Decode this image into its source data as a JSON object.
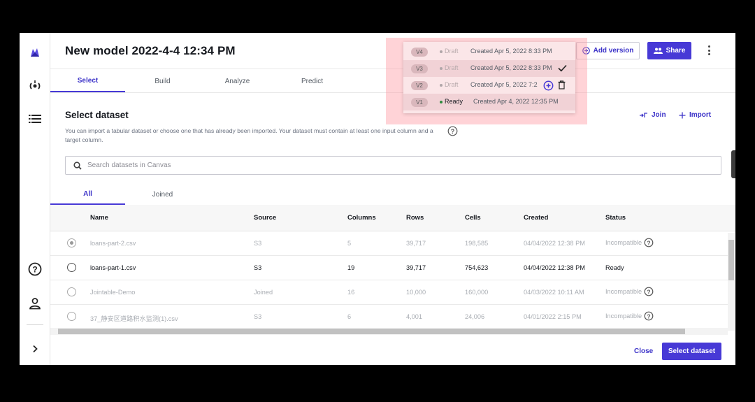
{
  "header": {
    "title": "New model 2022-4-4 12:34 PM",
    "add_version_label": "Add version",
    "share_label": "Share"
  },
  "tabs": [
    "Select",
    "Build",
    "Analyze",
    "Predict"
  ],
  "section": {
    "title": "Select dataset",
    "description": "You can import a tabular dataset or choose one that has already been imported. Your dataset must contain at least one input column and a target column.",
    "join_label": "Join",
    "import_label": "Import"
  },
  "search": {
    "placeholder": "Search datasets in Canvas",
    "value": ""
  },
  "sub_tabs": [
    "All",
    "Joined"
  ],
  "table": {
    "columns": [
      "Name",
      "Source",
      "Columns",
      "Rows",
      "Cells",
      "Created",
      "Status"
    ],
    "rows": [
      {
        "name": "loans-part-2.csv",
        "source": "S3",
        "columns": "5",
        "rows": "39,717",
        "cells": "198,585",
        "created": "04/04/2022 12:38 PM",
        "status": "Incompatible",
        "selected": true,
        "dim": true
      },
      {
        "name": "loans-part-1.csv",
        "source": "S3",
        "columns": "19",
        "rows": "39,717",
        "cells": "754,623",
        "created": "04/04/2022 12:38 PM",
        "status": "Ready",
        "selected": false,
        "dim": false
      },
      {
        "name": "Jointable-Demo",
        "source": "Joined",
        "columns": "16",
        "rows": "10,000",
        "cells": "160,000",
        "created": "04/03/2022 10:11 AM",
        "status": "Incompatible",
        "selected": false,
        "dim": true
      },
      {
        "name": "37_静安区道路积水监测(1).csv",
        "source": "S3",
        "columns": "6",
        "rows": "4,001",
        "cells": "24,006",
        "created": "04/01/2022 2:15 PM",
        "status": "Incompatible",
        "selected": false,
        "dim": true
      }
    ]
  },
  "footer": {
    "close_label": "Close",
    "select_label": "Select dataset"
  },
  "versions": [
    {
      "badge": "V4",
      "state": "Draft",
      "created": "Created Apr 5, 2022 8:33 PM"
    },
    {
      "badge": "V3",
      "state": "Draft",
      "created": "Created Apr 5, 2022 8:33 PM"
    },
    {
      "badge": "V2",
      "state": "Draft",
      "created": "Created Apr 5, 2022 7:2"
    },
    {
      "badge": "V1",
      "state": "Ready",
      "created": "Created Apr 4, 2022 12:35 PM"
    }
  ],
  "colors": {
    "accent": "#4739d6",
    "overlay": "#ff96a0",
    "ready_dot": "#2d8a3e"
  }
}
